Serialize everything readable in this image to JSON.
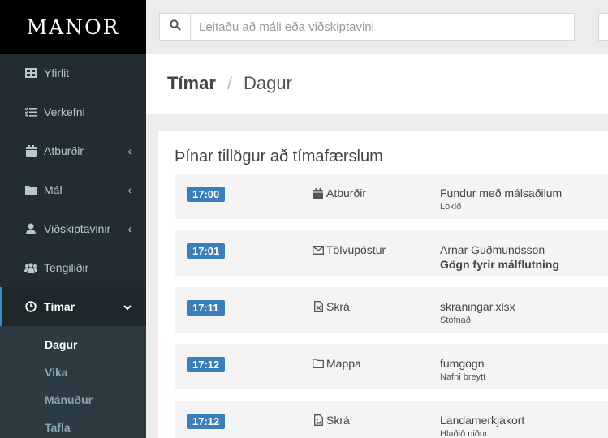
{
  "app": {
    "logo": "MANOR"
  },
  "search": {
    "placeholder": "Leitaðu að máli eða viðskiptavini",
    "icon": "search-icon"
  },
  "sidebar": {
    "items": [
      {
        "label": "Yfirlit",
        "icon": "dashboard-icon"
      },
      {
        "label": "Verkefni",
        "icon": "tasks-icon"
      },
      {
        "label": "Atburðir",
        "icon": "calendar-icon"
      },
      {
        "label": "Mál",
        "icon": "folder-icon"
      },
      {
        "label": "Viðskiptavinir",
        "icon": "user-icon"
      },
      {
        "label": "Tengiliðir",
        "icon": "users-icon"
      },
      {
        "label": "Tímar",
        "icon": "clock-icon"
      }
    ],
    "subitems": [
      {
        "label": "Dagur"
      },
      {
        "label": "Vika"
      },
      {
        "label": "Mánuður"
      },
      {
        "label": "Tafla"
      }
    ]
  },
  "breadcrumb": {
    "root": "Tímar",
    "separator": "/",
    "current": "Dagur"
  },
  "suggestions": {
    "title": "Þínar tillögur að tímafærslum",
    "rows": [
      {
        "time": "17:00",
        "type": "Atburðir",
        "type_icon": "calendar-icon",
        "title": "Fundur með málsaðilum",
        "subtitle": "Lokið"
      },
      {
        "time": "17:01",
        "type": "Tölvupóstur",
        "type_icon": "envelope-icon",
        "title": "Arnar Guðmundsson",
        "subtitle": "Gögn fyrir málflutning"
      },
      {
        "time": "17:11",
        "type": "Skrá",
        "type_icon": "excel-file-icon",
        "title": "skraningar.xlsx",
        "subtitle": "Stofnað"
      },
      {
        "time": "17:12",
        "type": "Mappa",
        "type_icon": "folder-open-icon",
        "title": "fumgogn",
        "subtitle": "Nafni breytt"
      },
      {
        "time": "17:12",
        "type": "Skrá",
        "type_icon": "image-file-icon",
        "title": "Landamerkjakort",
        "subtitle": "Hlaðið niður"
      }
    ]
  },
  "colors": {
    "sidebar_bg": "#222d32",
    "accent": "#3c8dbc",
    "badge": "#3c7fb8"
  }
}
